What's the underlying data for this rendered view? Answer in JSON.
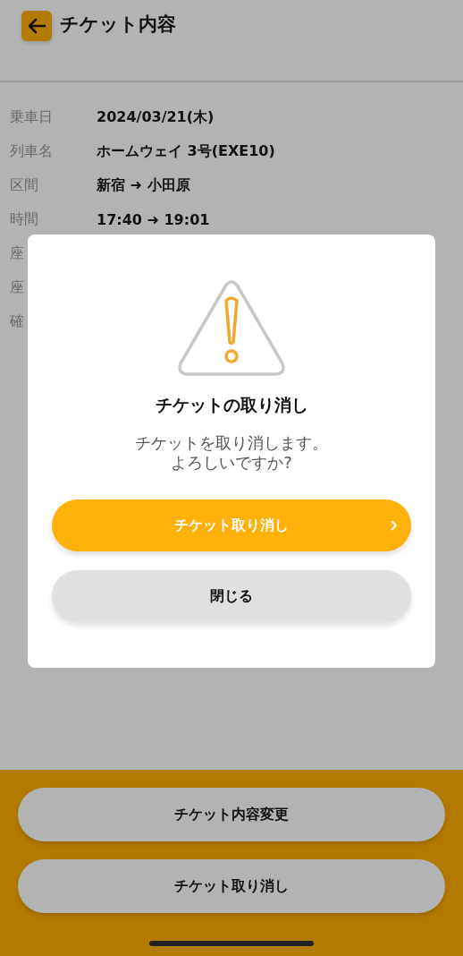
{
  "header": {
    "title": "チケット内容"
  },
  "details": [
    {
      "label": "乗車日",
      "value": "2024/03/21(木)"
    },
    {
      "label": "列車名",
      "value": "ホームウェイ 3号(EXE10)"
    },
    {
      "label": "区間",
      "value": "新宿 ➜ 小田原"
    },
    {
      "label": "時間",
      "value": "17:40 ➜ 19:01"
    },
    {
      "label": "座"
    },
    {
      "label": "座"
    },
    {
      "label": "確"
    }
  ],
  "dialog": {
    "title": "チケットの取り消し",
    "message": [
      "チケットを取り消します。",
      "よろしいですか?"
    ],
    "buttons": [
      {
        "label": "チケット取り消し",
        "kind": "primary"
      },
      {
        "label": "閉じる",
        "kind": "secondary"
      }
    ]
  },
  "footer": {
    "buttons": [
      {
        "label": "チケット内容変更"
      },
      {
        "label": "チケット取り消し"
      }
    ]
  }
}
